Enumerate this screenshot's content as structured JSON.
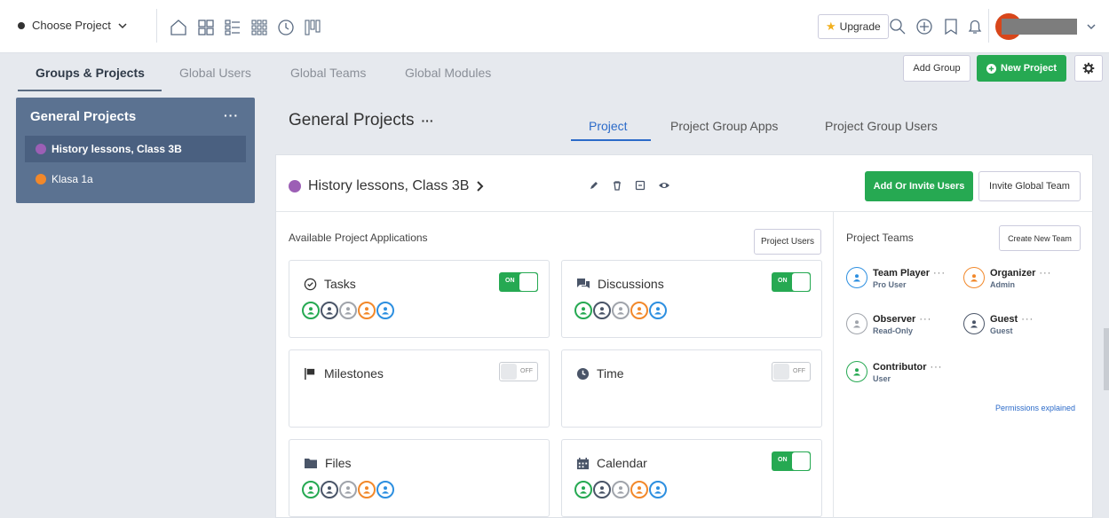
{
  "topbar": {
    "project_select": "Choose Project",
    "upgrade_label": "Upgrade"
  },
  "tabs": {
    "groups_projects": "Groups & Projects",
    "global_users": "Global Users",
    "global_teams": "Global Teams",
    "global_modules": "Global Modules",
    "add_group": "Add Group",
    "new_project": "New Project"
  },
  "sidebar": {
    "group_title": "General Projects",
    "group_more": "···",
    "items": [
      {
        "label": "History lessons, Class 3B",
        "color": "#9c5fb5"
      },
      {
        "label": "Klasa 1a",
        "color": "#f2882a"
      }
    ]
  },
  "main": {
    "title": "General Projects",
    "title_more": "···",
    "tabs": [
      "Project",
      "Project Group Apps",
      "Project Group Users"
    ]
  },
  "project": {
    "name": "History lessons, Class 3B",
    "color": "#9c5fb5",
    "add_users": "Add Or Invite Users",
    "invite_team": "Invite Global Team"
  },
  "apps": {
    "title": "Available Project Applications",
    "project_users": "Project Users",
    "on_label": "ON",
    "off_label": "OFF",
    "items": [
      {
        "name": "Tasks",
        "icon": "check-circle-icon",
        "enabled": true,
        "avatars": true
      },
      {
        "name": "Discussions",
        "icon": "chat-icon",
        "enabled": true,
        "avatars": true
      },
      {
        "name": "Milestones",
        "icon": "flag-icon",
        "enabled": false,
        "avatars": false
      },
      {
        "name": "Time",
        "icon": "clock-icon",
        "enabled": false,
        "avatars": false
      },
      {
        "name": "Files",
        "icon": "folder-icon",
        "enabled": null,
        "avatars": true
      },
      {
        "name": "Calendar",
        "icon": "calendar-icon",
        "enabled": true,
        "avatars": true
      }
    ],
    "avatar_colors": [
      "#26a952",
      "#4a5568",
      "#a0a4ab",
      "#f2882a",
      "#2d8fe0"
    ]
  },
  "teams": {
    "title": "Project Teams",
    "create": "Create New Team",
    "permissions": "Permissions explained",
    "items": [
      {
        "name": "Team Player",
        "role": "Pro User",
        "color": "#2d8fe0"
      },
      {
        "name": "Organizer",
        "role": "Admin",
        "color": "#f2882a"
      },
      {
        "name": "Observer",
        "role": "Read-Only",
        "color": "#a0a4ab"
      },
      {
        "name": "Guest",
        "role": "Guest",
        "color": "#4a5568"
      },
      {
        "name": "Contributor",
        "role": "User",
        "color": "#26a952"
      }
    ]
  }
}
